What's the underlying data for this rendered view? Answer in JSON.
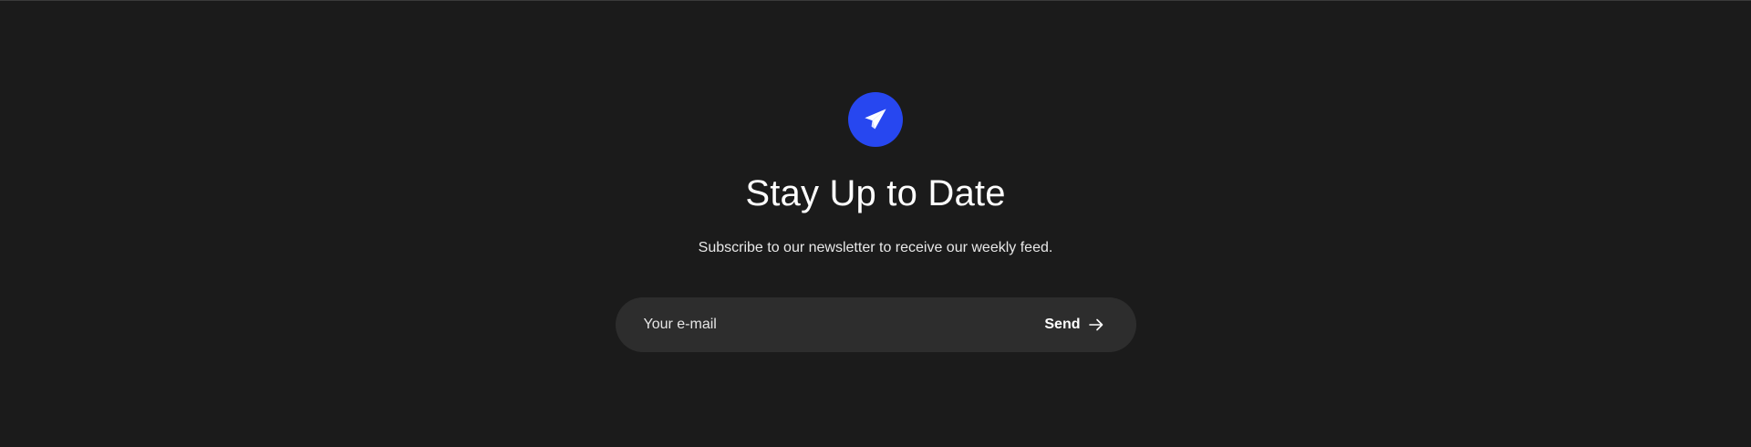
{
  "newsletter": {
    "icon": "paper-plane-icon",
    "title": "Stay Up to Date",
    "subtitle": "Subscribe to our newsletter to receive our weekly feed.",
    "email_placeholder": "Your e-mail",
    "send_label": "Send",
    "send_icon": "arrow-right-icon"
  },
  "colors": {
    "background": "#1b1b1b",
    "accent": "#2747f0",
    "input_background": "#2d2d2d",
    "text": "#ffffff"
  }
}
